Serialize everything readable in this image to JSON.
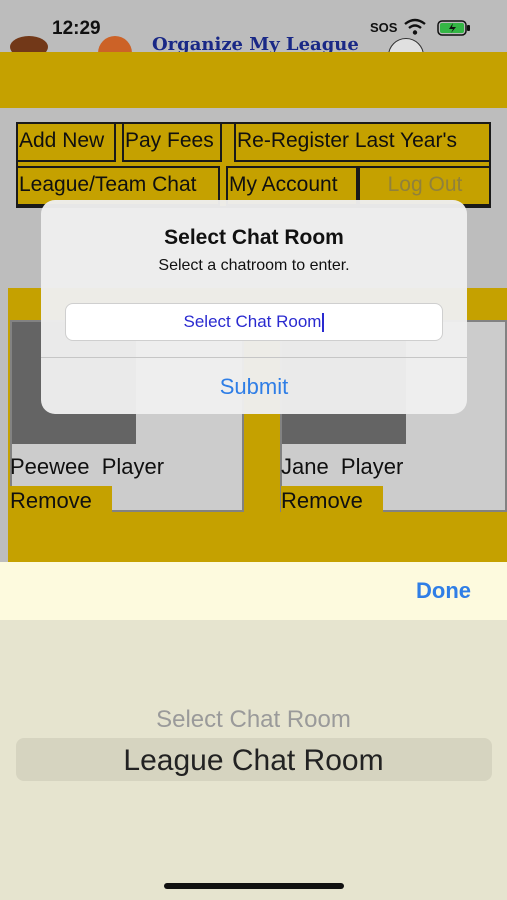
{
  "status": {
    "time": "12:29",
    "sos": "SOS"
  },
  "app": {
    "title": "Organize My League"
  },
  "nav": {
    "add_new": "Add New",
    "pay_fees": "Pay Fees",
    "re_register": "Re-Register Last Year's",
    "league_team_chat": "League/Team Chat",
    "my_account": "My Account",
    "log_out": "Log Out"
  },
  "players": [
    {
      "name": "Peewee  Player",
      "remove": "Remove"
    },
    {
      "name": "Jane  Player",
      "remove": "Remove"
    }
  ],
  "alert": {
    "title": "Select Chat Room",
    "message": "Select a chatroom to enter.",
    "field_value": "Select Chat Room",
    "submit": "Submit"
  },
  "toolbar": {
    "done": "Done"
  },
  "picker": {
    "options": [
      "Select Chat Room",
      "League Chat Room"
    ],
    "selected": "League Chat Room"
  },
  "colors": {
    "gold": "#d2ac00",
    "link_blue": "#2f7ee6"
  }
}
